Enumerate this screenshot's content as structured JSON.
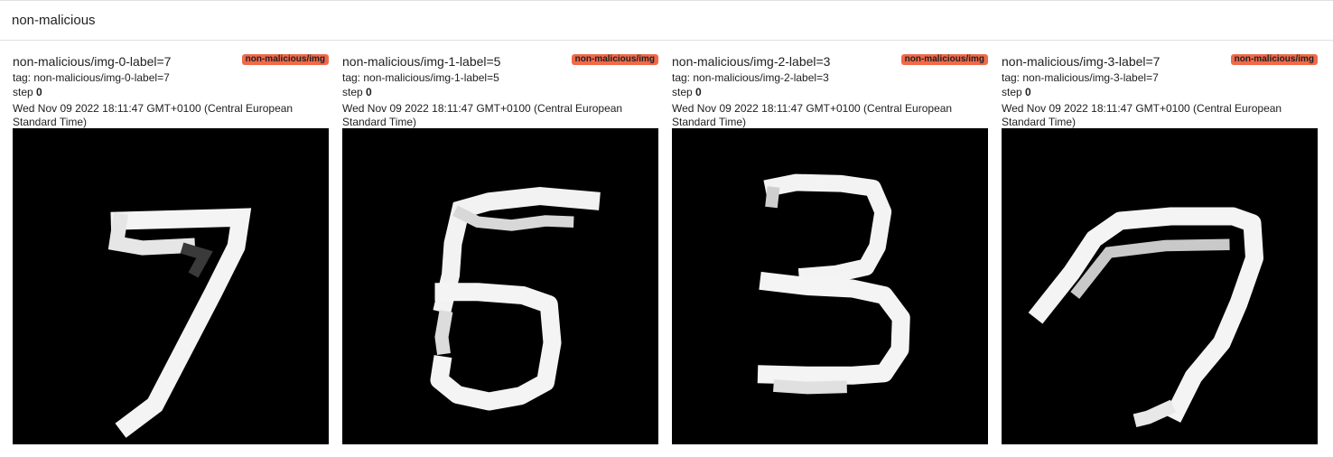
{
  "section": {
    "title": "non-malicious"
  },
  "cards": [
    {
      "title": "non-malicious/img-0-label=7",
      "badge": "non-malicious/img",
      "tag": "tag: non-malicious/img-0-label=7",
      "step_label": "step",
      "step_value": "0",
      "timestamp": "Wed Nov 09 2022 18:11:47 GMT+0100 (Central European Standard Time)",
      "digit": "7"
    },
    {
      "title": "non-malicious/img-1-label=5",
      "badge": "non-malicious/img",
      "tag": "tag: non-malicious/img-1-label=5",
      "step_label": "step",
      "step_value": "0",
      "timestamp": "Wed Nov 09 2022 18:11:47 GMT+0100 (Central European Standard Time)",
      "digit": "5"
    },
    {
      "title": "non-malicious/img-2-label=3",
      "badge": "non-malicious/img",
      "tag": "tag: non-malicious/img-2-label=3",
      "step_label": "step",
      "step_value": "0",
      "timestamp": "Wed Nov 09 2022 18:11:47 GMT+0100 (Central European Standard Time)",
      "digit": "3"
    },
    {
      "title": "non-malicious/img-3-label=7",
      "badge": "non-malicious/img",
      "tag": "tag: non-malicious/img-3-label=7",
      "step_label": "step",
      "step_value": "0",
      "timestamp": "Wed Nov 09 2022 18:11:47 GMT+0100 (Central European Standard Time)",
      "digit": "7"
    }
  ],
  "colors": {
    "badge": "#ef6a4a",
    "image_background": "#000000",
    "stroke": "#ffffff"
  }
}
